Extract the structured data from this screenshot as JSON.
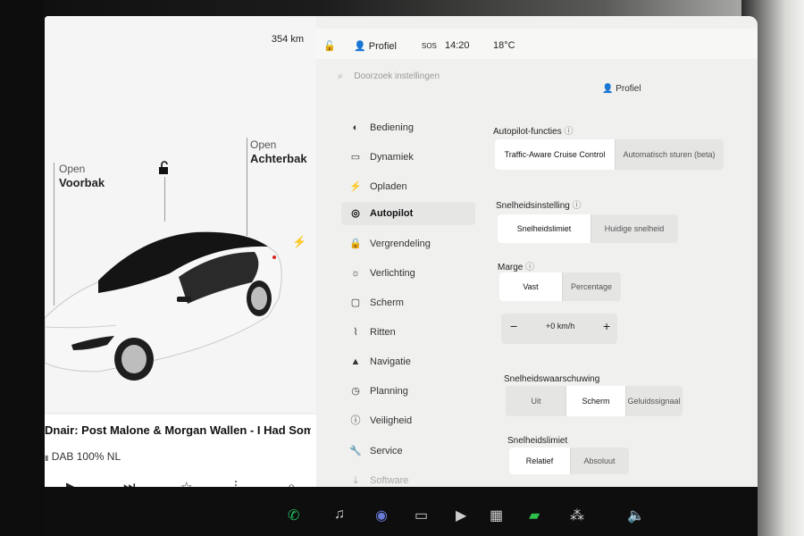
{
  "car": {
    "range": "354 km",
    "frunk_open": "Open",
    "frunk_name": "Voorbak",
    "trunk_open": "Open",
    "trunk_name": "Achterbak",
    "lock_icon": "lock-open-icon",
    "charge_icon": "bolt-icon"
  },
  "media": {
    "track": "Dnair: Post Malone & Morgan Wallen - I Had Some",
    "station": "DAB 100% NL",
    "controls": [
      "play-icon",
      "next-icon",
      "star-icon",
      "equalizer-icon",
      "search-icon"
    ]
  },
  "status": {
    "profile": "Profiel",
    "sos": "SOS",
    "time": "14:20",
    "temp": "18°C"
  },
  "search": {
    "placeholder": "Doorzoek instellingen"
  },
  "header_profile": "Profiel",
  "menu": [
    {
      "label": "Bediening",
      "icon": "toggle-icon"
    },
    {
      "label": "Dynamiek",
      "icon": "car-icon"
    },
    {
      "label": "Opladen",
      "icon": "bolt-icon"
    },
    {
      "label": "Autopilot",
      "icon": "steering-wheel-icon",
      "active": true
    },
    {
      "label": "Vergrendeling",
      "icon": "lock-icon"
    },
    {
      "label": "Verlichting",
      "icon": "sun-icon"
    },
    {
      "label": "Scherm",
      "icon": "display-icon"
    },
    {
      "label": "Ritten",
      "icon": "trips-icon"
    },
    {
      "label": "Navigatie",
      "icon": "navigation-icon"
    },
    {
      "label": "Planning",
      "icon": "clock-icon"
    },
    {
      "label": "Veiligheid",
      "icon": "info-icon"
    },
    {
      "label": "Service",
      "icon": "wrench-icon"
    },
    {
      "label": "Software",
      "icon": "download-icon"
    }
  ],
  "autopilot": {
    "features_title": "Autopilot-functies",
    "features": [
      "Traffic-Aware Cruise Control",
      "Automatisch sturen (beta)"
    ],
    "speed_setting_title": "Snelheidsinstelling",
    "speed_setting": [
      "Snelheidslimiet",
      "Huidige snelheid"
    ],
    "margin_title": "Marge",
    "margin": [
      "Vast",
      "Percentage"
    ],
    "offset_minus": "−",
    "offset": "+0 km/h",
    "offset_plus": "+",
    "warning_title": "Snelheidswaarschuwing",
    "warning": [
      "Uit",
      "Scherm",
      "Geluidssignaal"
    ],
    "limit_title": "Snelheidslimiet",
    "limit": [
      "Relatief",
      "Absoluut"
    ]
  }
}
